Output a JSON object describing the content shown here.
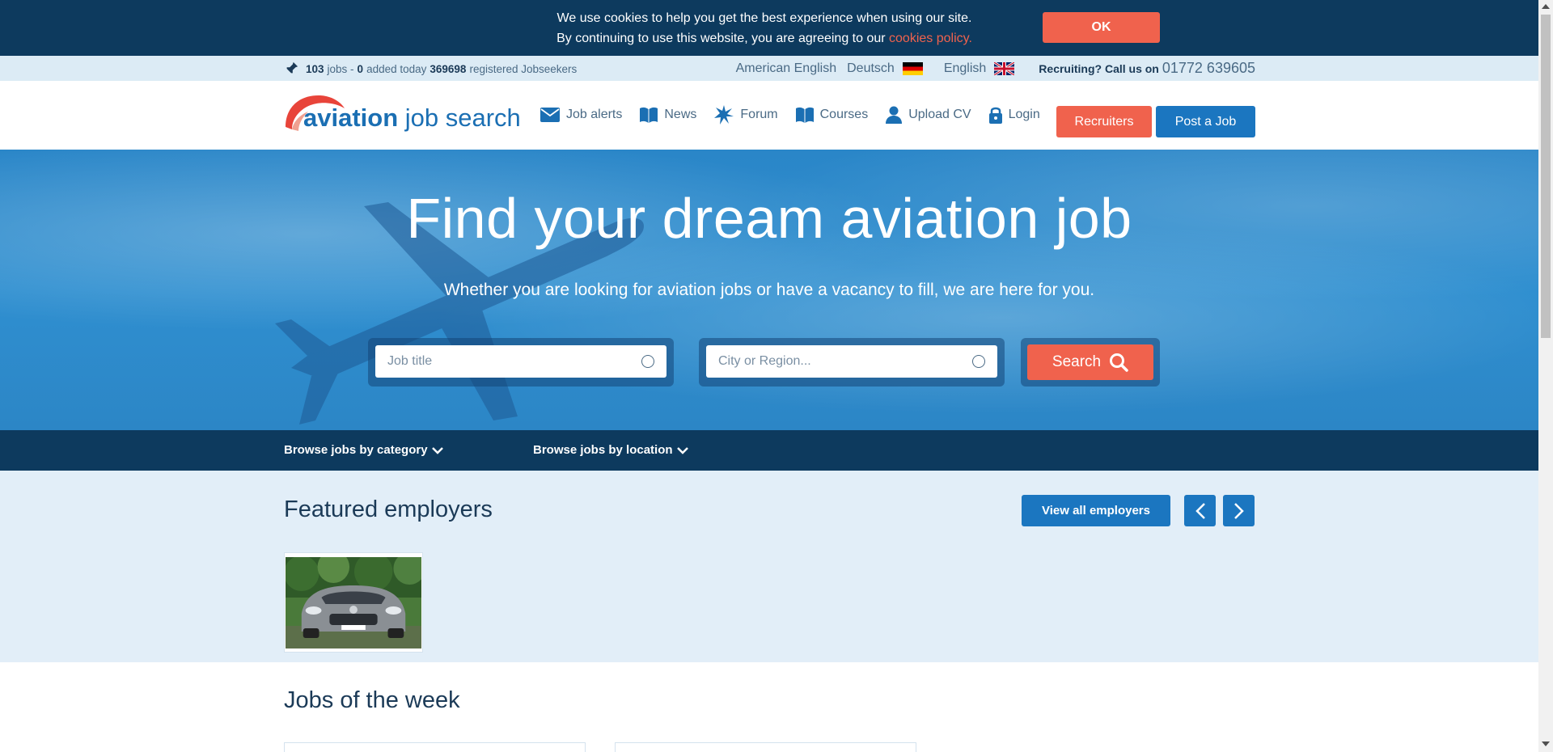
{
  "cookie": {
    "line1": "We use cookies to help you get the best experience when using our site.",
    "line2_prefix": "By continuing to use this website, you are agreeing to our ",
    "link": "cookies policy.",
    "ok_label": "OK"
  },
  "info": {
    "jobs_count": "103",
    "jobs_label": "jobs -",
    "added_count": "0",
    "added_label": "added today",
    "seekers_count": "369698",
    "seekers_label": "registered Jobseekers",
    "lang_american": "American English",
    "lang_deutsch": "Deutsch",
    "lang_english": "English",
    "recruit_label": "Recruiting? Call us on",
    "phone": "01772 639605"
  },
  "header": {
    "logo_bold": "aviation",
    "logo_light": " job search",
    "nav": {
      "job_alerts": "Job alerts",
      "news": "News",
      "forum": "Forum",
      "courses": "Courses",
      "upload_cv": "Upload CV",
      "login": "Login"
    },
    "recruiters_label": "Recruiters",
    "post_job_label": "Post a Job"
  },
  "hero": {
    "title": "Find your dream aviation job",
    "subtitle": "Whether you are looking for aviation jobs or have a vacancy to fill, we are here for you.",
    "job_placeholder": "Job title",
    "location_placeholder": "City or Region...",
    "search_label": "Search"
  },
  "browse": {
    "by_category": "Browse jobs by category",
    "by_location": "Browse jobs by location"
  },
  "featured": {
    "title": "Featured employers",
    "view_all_label": "View all employers"
  },
  "jobs_week": {
    "title": "Jobs of the week"
  },
  "colors": {
    "navy": "#0d3a5e",
    "accent_orange": "#f0624d",
    "primary_blue": "#1b76c0",
    "light_blue_bg": "#e2eef8"
  }
}
